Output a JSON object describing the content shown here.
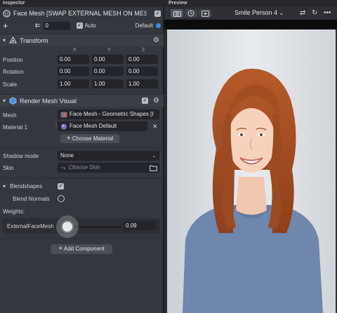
{
  "inspector": {
    "panel_title": "Inspector",
    "object_title": "Face Mesh [SWAP EXTERNAL MESH ON MES",
    "layer_value": "0",
    "auto_label": "Auto",
    "default_label": "Default"
  },
  "transform": {
    "title": "Transform",
    "axes": [
      "X",
      "Y",
      "Z"
    ],
    "rows": [
      {
        "label": "Position",
        "values": [
          "0.00",
          "0.00",
          "0.00"
        ]
      },
      {
        "label": "Rotation",
        "values": [
          "0.00",
          "0.00",
          "0.00"
        ]
      },
      {
        "label": "Scale",
        "values": [
          "1.00",
          "1.00",
          "1.00"
        ]
      }
    ]
  },
  "render_mesh": {
    "title": "Render Mesh Visual",
    "mesh_label": "Mesh",
    "mesh_value": "Face Mesh - Geometric Shapes [I",
    "material_label": "Material 1",
    "material_value": "Face Mesh Default",
    "choose_material": "Choose Material",
    "shadow_label": "Shadow mode",
    "shadow_value": "None",
    "skin_label": "Skin",
    "skin_placeholder": "Choose Skin",
    "blendshapes_label": "Blendshapes",
    "blendshapes_checked": true,
    "blend_normals_label": "Blend Normals",
    "blend_normals_checked": false,
    "weights_label": "Weights:",
    "weight_name": "ExternalFaceMesh",
    "weight_value": "0.09",
    "weight_fraction": 0.09
  },
  "add_component": "Add Component",
  "preview": {
    "panel_title": "Preview",
    "person_select": "Smile Person 4"
  },
  "colors": {
    "accent_blue": "#3a8ee6",
    "panel_bg": "#34373d",
    "field_bg": "#23252a"
  },
  "icons": {
    "object": "face-mesh-icon",
    "transform": "transform-icon",
    "render_mesh": "render-mesh-icon",
    "gear": "gear-icon",
    "folder": "folder-icon",
    "close": "close-icon"
  }
}
